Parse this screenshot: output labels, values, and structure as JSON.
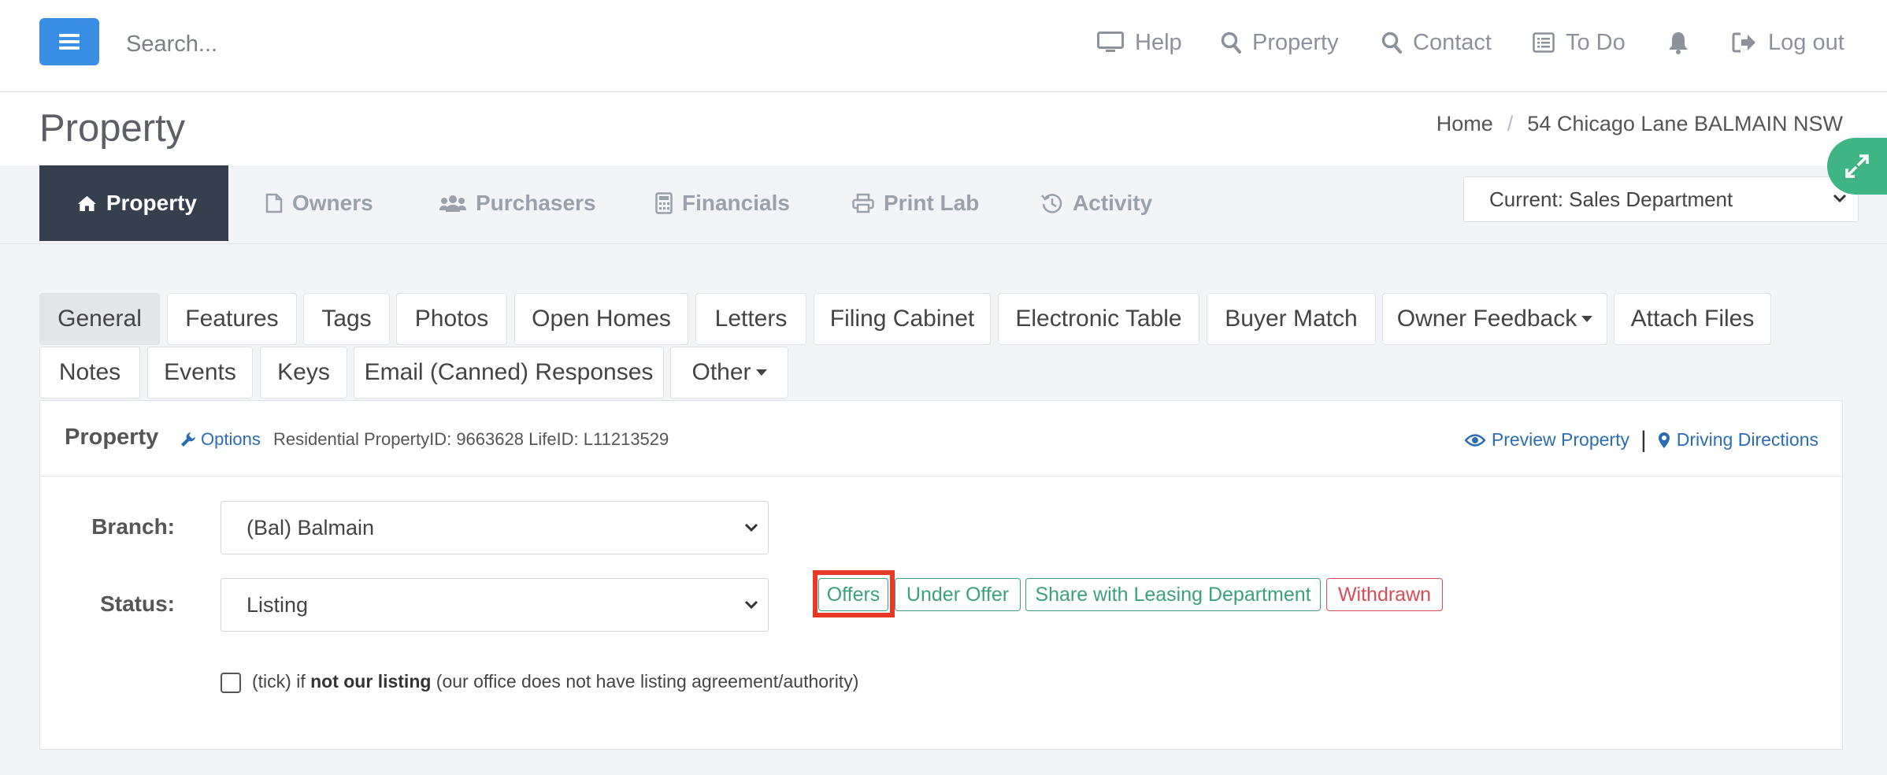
{
  "topbar": {
    "search_placeholder": "Search...",
    "nav": [
      {
        "label": "Help",
        "icon": "monitor-icon"
      },
      {
        "label": "Property",
        "icon": "search-icon"
      },
      {
        "label": "Contact",
        "icon": "search-icon"
      },
      {
        "label": "To Do",
        "icon": "list-icon"
      },
      {
        "label": "",
        "icon": "bell-icon"
      },
      {
        "label": "Log out",
        "icon": "logout-icon"
      }
    ]
  },
  "header": {
    "title": "Property",
    "breadcrumb": [
      "Home",
      "54 Chicago Lane BALMAIN NSW"
    ]
  },
  "main_tabs": [
    {
      "label": "Property",
      "icon": "home-icon",
      "active": true
    },
    {
      "label": "Owners",
      "icon": "file-icon"
    },
    {
      "label": "Purchasers",
      "icon": "users-icon"
    },
    {
      "label": "Financials",
      "icon": "calculator-icon"
    },
    {
      "label": "Print Lab",
      "icon": "printer-icon"
    },
    {
      "label": "Activity",
      "icon": "history-icon"
    }
  ],
  "department_select": {
    "value": "Current: Sales Department"
  },
  "sub_tabs_row1": [
    "General",
    "Features",
    "Tags",
    "Photos",
    "Open Homes",
    "Letters",
    "Filing Cabinet",
    "Electronic Table",
    "Buyer Match",
    "Owner Feedback",
    "Attach Files"
  ],
  "sub_tabs_row2": [
    "Notes",
    "Events",
    "Keys",
    "Email (Canned) Responses",
    "Other"
  ],
  "panel": {
    "title": "Property",
    "options_label": "Options",
    "meta": "Residential PropertyID: 9663628  LifeID: L11213529",
    "preview_label": "Preview Property",
    "directions_label": "Driving Directions",
    "branch_label": "Branch:",
    "branch_value": "(Bal) Balmain",
    "status_label": "Status:",
    "status_value": "Listing",
    "status_buttons": [
      "Offers",
      "Under Offer",
      "Share with Leasing Department",
      "Withdrawn"
    ],
    "checkbox_prefix": "(tick) if ",
    "checkbox_bold": "not our listing",
    "checkbox_suffix": " (our office does not have listing agreement/authority)"
  },
  "colors": {
    "accent": "#3a8fe5",
    "active_tab": "#363f4e",
    "green": "#3aa17b",
    "red": "#d94d58",
    "highlight": "#e63a24",
    "link": "#2a6db5"
  }
}
